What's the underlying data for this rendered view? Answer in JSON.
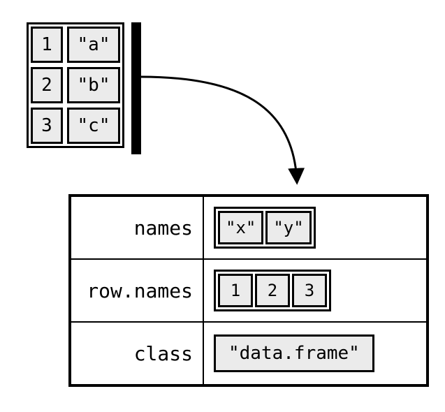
{
  "data_table": {
    "columns": [
      {
        "type": "int",
        "values": [
          "1",
          "2",
          "3"
        ]
      },
      {
        "type": "str",
        "values": [
          "\"a\"",
          "\"b\"",
          "\"c\""
        ]
      }
    ]
  },
  "attributes": {
    "names": {
      "label": "names",
      "values": [
        "\"x\"",
        "\"y\""
      ]
    },
    "row_names": {
      "label": "row.names",
      "values": [
        "1",
        "2",
        "3"
      ]
    },
    "class": {
      "label": "class",
      "value": "\"data.frame\""
    }
  }
}
